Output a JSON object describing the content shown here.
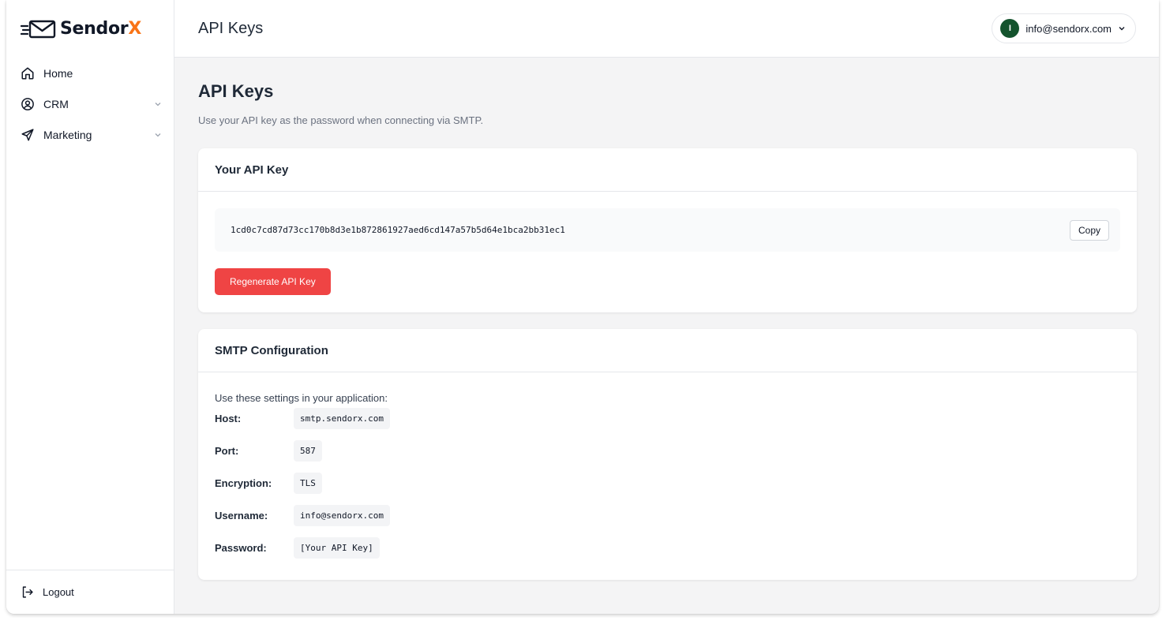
{
  "brand": {
    "name": "Sendor",
    "suffix": "X"
  },
  "sidebar": {
    "items": [
      {
        "label": "Home"
      },
      {
        "label": "CRM"
      },
      {
        "label": "Marketing"
      }
    ],
    "logout": "Logout"
  },
  "header": {
    "title": "API Keys",
    "user_initial": "I",
    "user_email": "info@sendorx.com"
  },
  "page": {
    "title": "API Keys",
    "subtitle": "Use your API key as the password when connecting via SMTP."
  },
  "api_card": {
    "title": "Your API Key",
    "key": "1cd0c7cd87d73cc170b8d3e1b872861927aed6cd147a57b5d64e1bca2bb31ec1",
    "copy_label": "Copy",
    "regenerate_label": "Regenerate API Key"
  },
  "smtp_card": {
    "title": "SMTP Configuration",
    "intro": "Use these settings in your application:",
    "rows": [
      {
        "label": "Host:",
        "value": "smtp.sendorx.com"
      },
      {
        "label": "Port:",
        "value": "587"
      },
      {
        "label": "Encryption:",
        "value": "TLS"
      },
      {
        "label": "Username:",
        "value": "info@sendorx.com"
      },
      {
        "label": "Password:",
        "value": "[Your API Key]"
      }
    ]
  },
  "colors": {
    "accent": "#f97316",
    "danger": "#ef4444",
    "avatar": "#14532d"
  },
  "icons": [
    "envelope-logo-icon",
    "home-icon",
    "user-circle-icon",
    "send-icon",
    "chevron-down-icon",
    "logout-icon"
  ]
}
